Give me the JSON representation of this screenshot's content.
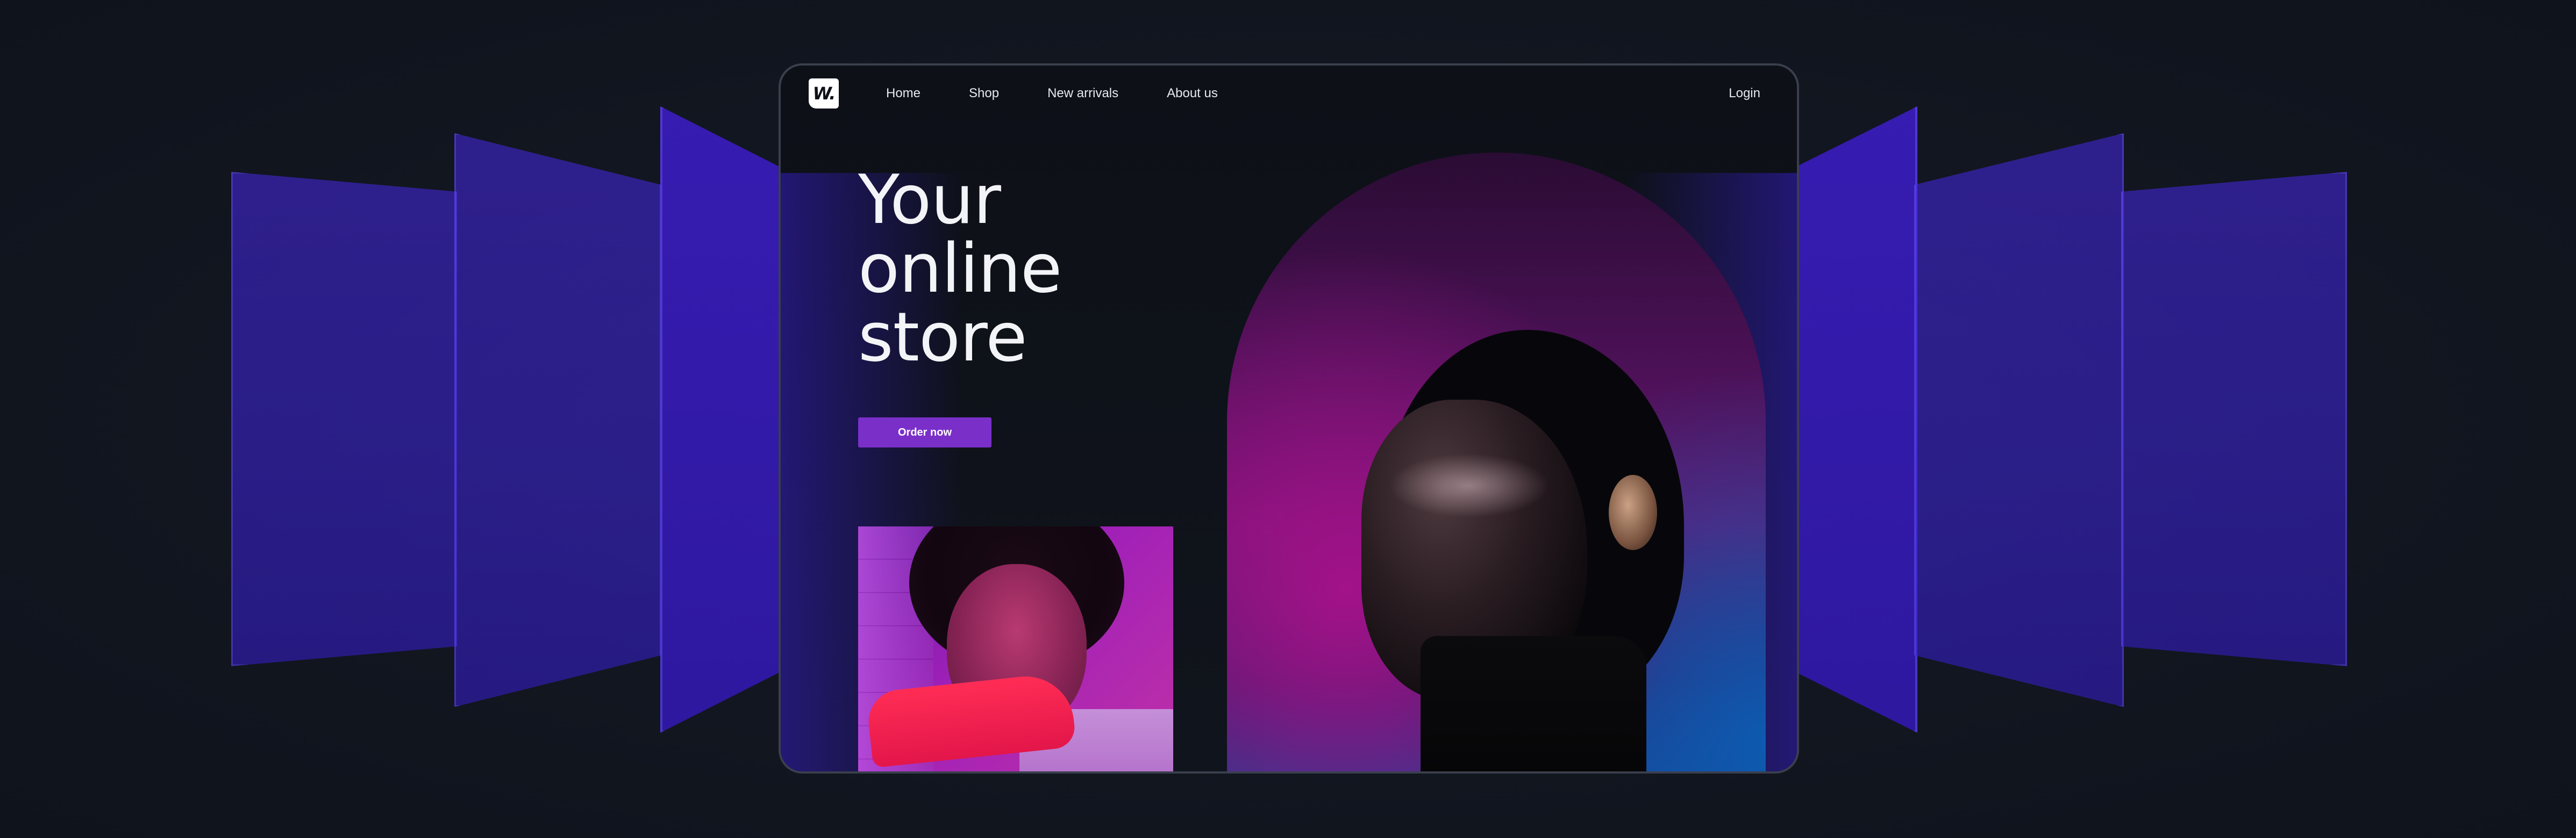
{
  "brand": {
    "logo_text": "W."
  },
  "nav": {
    "items": [
      {
        "label": "Home"
      },
      {
        "label": "Shop"
      },
      {
        "label": "New arrivals"
      },
      {
        "label": "About us"
      }
    ],
    "login_label": "Login"
  },
  "hero": {
    "title_lines": [
      "Your",
      "online",
      "store"
    ],
    "cta_label": "Order now"
  },
  "colors": {
    "accent": "#7a2fc9",
    "background": "#121620",
    "panel": "#3a1ec8"
  }
}
